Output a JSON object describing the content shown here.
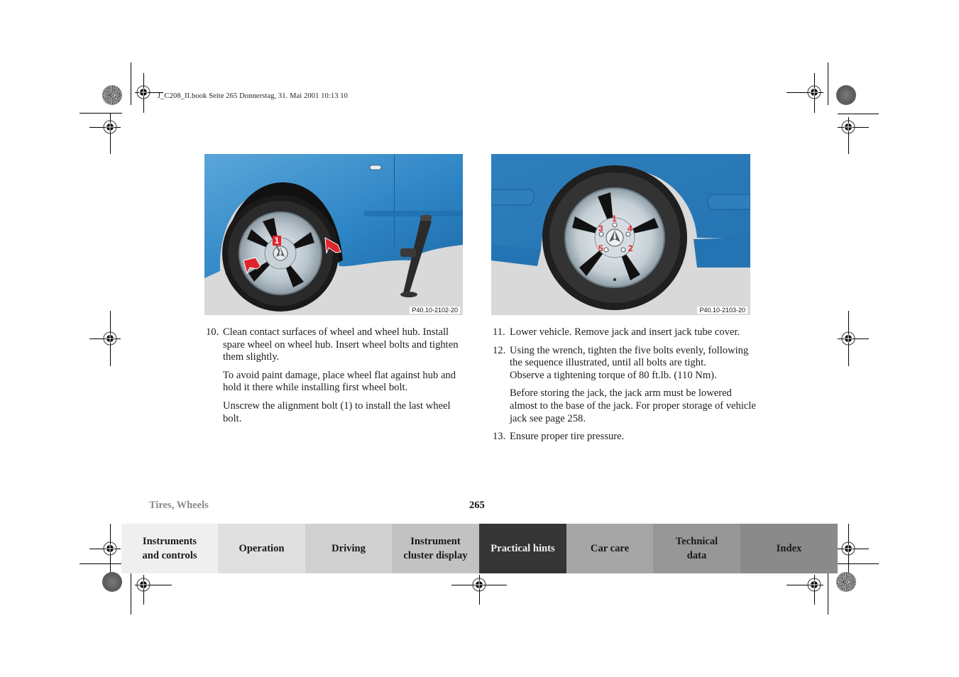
{
  "header": {
    "print_meta": "J_C208_II.book  Seite 265  Donnerstag, 31. Mai 2001  10:13 10"
  },
  "figures": [
    {
      "id": "left",
      "caption": "P40.10-2102-20",
      "callouts": [
        "1"
      ],
      "icons": [
        "wheel-icon",
        "jack-icon",
        "arrow-icon"
      ]
    },
    {
      "id": "right",
      "caption": "P40.10-2103-20",
      "callouts": [
        "1",
        "2",
        "3",
        "4",
        "5"
      ],
      "icons": [
        "wheel-icon"
      ]
    }
  ],
  "colors": {
    "car_blue": "#2a7fbf",
    "ground": "#d9d9d9",
    "callout_red": "#e0242b",
    "tab_active": "#353535"
  },
  "left_column": {
    "steps": [
      {
        "number": "10.",
        "paragraphs": [
          "Clean contact surfaces of wheel and wheel hub. Install spare wheel on wheel hub. Insert wheel bolts and tighten them slightly.",
          "To avoid paint damage, place wheel flat against hub and hold it there while installing first wheel bolt.",
          "Unscrew the alignment bolt (1) to install the last wheel bolt."
        ]
      }
    ]
  },
  "right_column": {
    "steps": [
      {
        "number": "11.",
        "paragraphs": [
          "Lower vehicle. Remove jack and insert jack tube cover."
        ]
      },
      {
        "number": "12.",
        "paragraphs": [
          "Using the wrench, tighten the five bolts evenly, following the sequence illustrated, until all bolts are tight.\nObserve a tightening torque of 80 ft.lb. (110 Nm).",
          "Before storing the jack, the jack arm must be lowered almost to the base of the jack. For proper storage of vehicle jack see page 258."
        ]
      },
      {
        "number": "13.",
        "paragraphs": [
          "Ensure proper tire pressure."
        ]
      }
    ]
  },
  "footer": {
    "section_title": "Tires, Wheels",
    "page_number": "265"
  },
  "tabs": [
    {
      "label": "Instruments\nand controls",
      "bg": "#efefef",
      "active": false
    },
    {
      "label": "Operation",
      "bg": "#e0e0e0",
      "active": false
    },
    {
      "label": "Driving",
      "bg": "#d0d0d0",
      "active": false
    },
    {
      "label": "Instrument\ncluster display",
      "bg": "#c2c2c2",
      "active": false
    },
    {
      "label": "Practical hints",
      "bg": "#353535",
      "active": true
    },
    {
      "label": "Car care",
      "bg": "#a6a6a6",
      "active": false
    },
    {
      "label": "Technical\ndata",
      "bg": "#979797",
      "active": false
    },
    {
      "label": "Index",
      "bg": "#8a8a8a",
      "active": false
    }
  ]
}
